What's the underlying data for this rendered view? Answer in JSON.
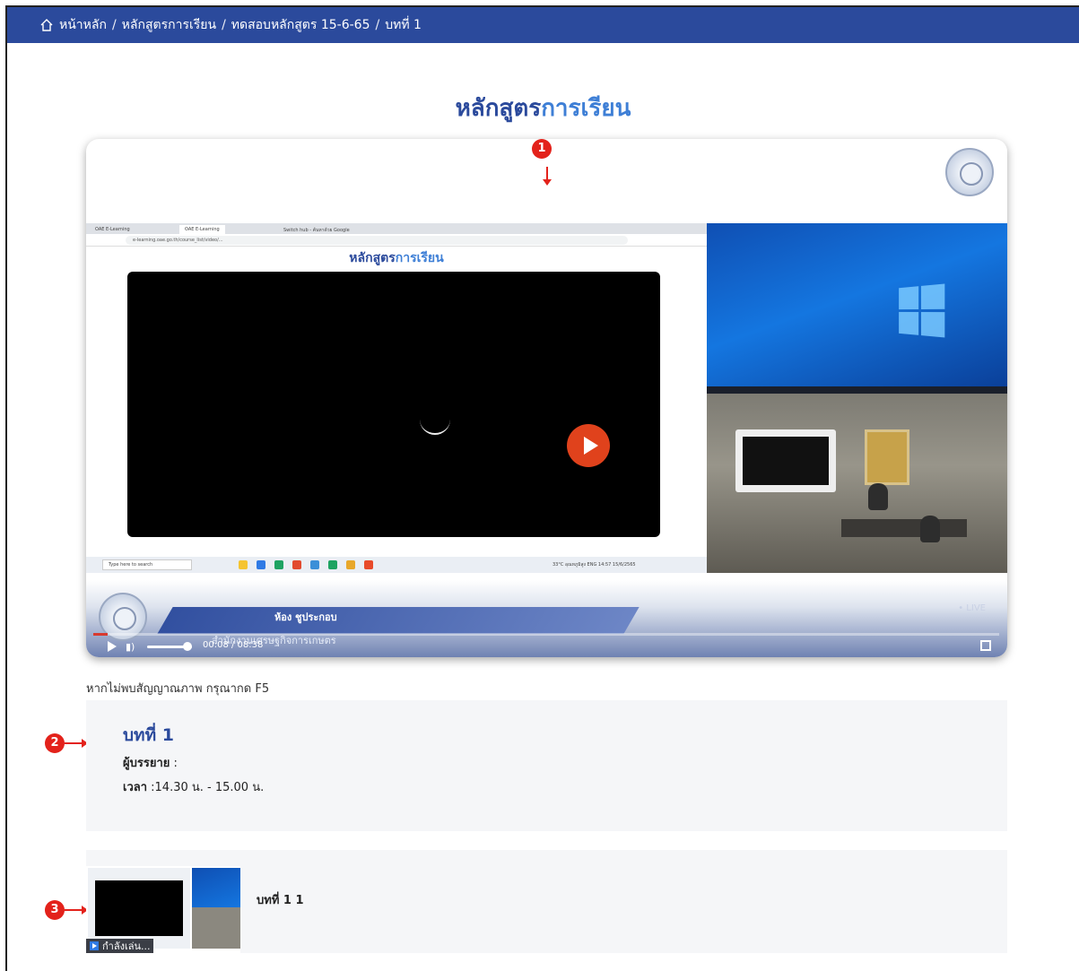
{
  "breadcrumb": {
    "items": [
      "หน้าหลัก",
      "หลักสูตรการเรียน",
      "ทดสอบหลักสูตร 15-6-65",
      "บทที่ 1"
    ],
    "separator": "/"
  },
  "page_title": {
    "part1": "หลักสูตร",
    "part2": "การเรียน"
  },
  "player": {
    "inner_title": {
      "part1": "หลักสูตร",
      "part2": "การเรียน"
    },
    "browser_tabs": [
      "OAE E-Learning",
      "OAE E-Learning",
      "Switch hub - ค้นหาด้วย Google"
    ],
    "url": "e-learning.oae.go.th/course_list/video/...",
    "taskbar_search": "Type here to search",
    "taskbar_status": "33°C อุณหภูมิสูง  ENG  14:57  15/6/2565",
    "presenter_name": "ห้อง ชูประกอบ",
    "org_name": "สำนักงานเศรษฐกิจการเกษตร",
    "live_label": "• LIVE",
    "time": "00:08 / 08:38",
    "progress": 0.016
  },
  "markers": [
    "1",
    "2",
    "3"
  ],
  "hint": "หากไม่พบสัญญาณภาพ กรุณากด F5",
  "lesson": {
    "title": "บทที่ 1",
    "lecturer_label": "ผู้บรรยาย",
    "lecturer_value": " :",
    "time_label": "เวลา",
    "time_value": " :14.30 น. - 15.00 น."
  },
  "playlist": {
    "items": [
      {
        "label": "บทที่ 1 1",
        "status": "กำลังเล่น..."
      }
    ]
  },
  "colors": {
    "brand": "#2b4a9c",
    "accent": "#3e7fd6",
    "marker": "#e3221b"
  }
}
